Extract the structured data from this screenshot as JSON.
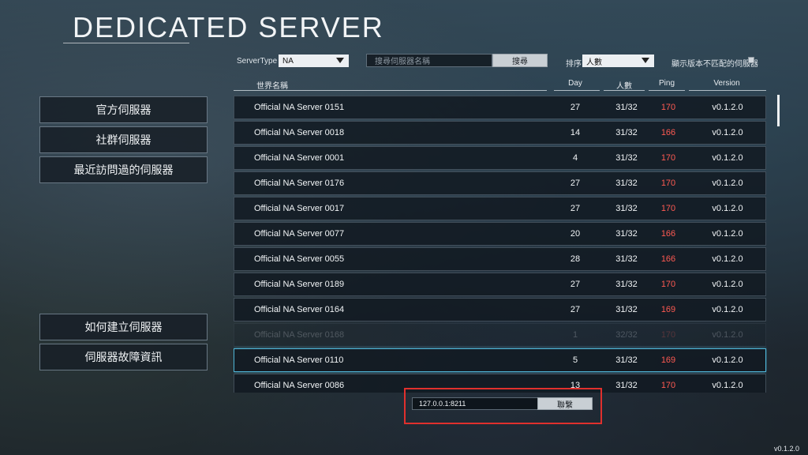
{
  "page": {
    "title": "DEDICATED SERVER",
    "version": "v0.1.2.0"
  },
  "menu": {
    "official": "官方伺服器",
    "community": "社群伺服器",
    "recent": "最近訪問過的伺服器",
    "how_to_build": "如何建立伺服器",
    "troubleshooting": "伺服器故障資訊"
  },
  "filters": {
    "server_type_label": "ServerType",
    "server_type_value": "NA",
    "search_placeholder": "搜尋伺服器名稱",
    "search_button": "搜尋",
    "sort_label": "排序",
    "sort_value": "人數",
    "mismatch_label": "顯示版本不匹配的伺服器",
    "mismatch_checked": false
  },
  "table": {
    "headers": {
      "name": "世界名稱",
      "day": "Day",
      "players": "人數",
      "ping": "Ping",
      "version": "Version"
    },
    "rows": [
      {
        "name": "Official NA Server 0151",
        "day": "27",
        "players": "31/32",
        "ping": "170",
        "version": "v0.1.2.0"
      },
      {
        "name": "Official NA Server 0018",
        "day": "14",
        "players": "31/32",
        "ping": "166",
        "version": "v0.1.2.0"
      },
      {
        "name": "Official NA Server 0001",
        "day": "4",
        "players": "31/32",
        "ping": "170",
        "version": "v0.1.2.0"
      },
      {
        "name": "Official NA Server 0176",
        "day": "27",
        "players": "31/32",
        "ping": "170",
        "version": "v0.1.2.0"
      },
      {
        "name": "Official NA Server 0017",
        "day": "27",
        "players": "31/32",
        "ping": "170",
        "version": "v0.1.2.0"
      },
      {
        "name": "Official NA Server 0077",
        "day": "20",
        "players": "31/32",
        "ping": "166",
        "version": "v0.1.2.0"
      },
      {
        "name": "Official NA Server 0055",
        "day": "28",
        "players": "31/32",
        "ping": "166",
        "version": "v0.1.2.0"
      },
      {
        "name": "Official NA Server 0189",
        "day": "27",
        "players": "31/32",
        "ping": "170",
        "version": "v0.1.2.0"
      },
      {
        "name": "Official NA Server 0164",
        "day": "27",
        "players": "31/32",
        "ping": "169",
        "version": "v0.1.2.0"
      },
      {
        "name": "Official NA Server 0168",
        "day": "1",
        "players": "32/32",
        "ping": "170",
        "version": "v0.1.2.0"
      },
      {
        "name": "Official NA Server 0110",
        "day": "5",
        "players": "31/32",
        "ping": "169",
        "version": "v0.1.2.0"
      },
      {
        "name": "Official NA Server 0086",
        "day": "13",
        "players": "31/32",
        "ping": "170",
        "version": "v0.1.2.0"
      }
    ]
  },
  "connect": {
    "address": "127.0.0.1:8211",
    "button": "聯繫"
  },
  "colors": {
    "ping": "#ff5a52",
    "selected_border": "#4fb6d8",
    "highlight": "#e0302d"
  }
}
